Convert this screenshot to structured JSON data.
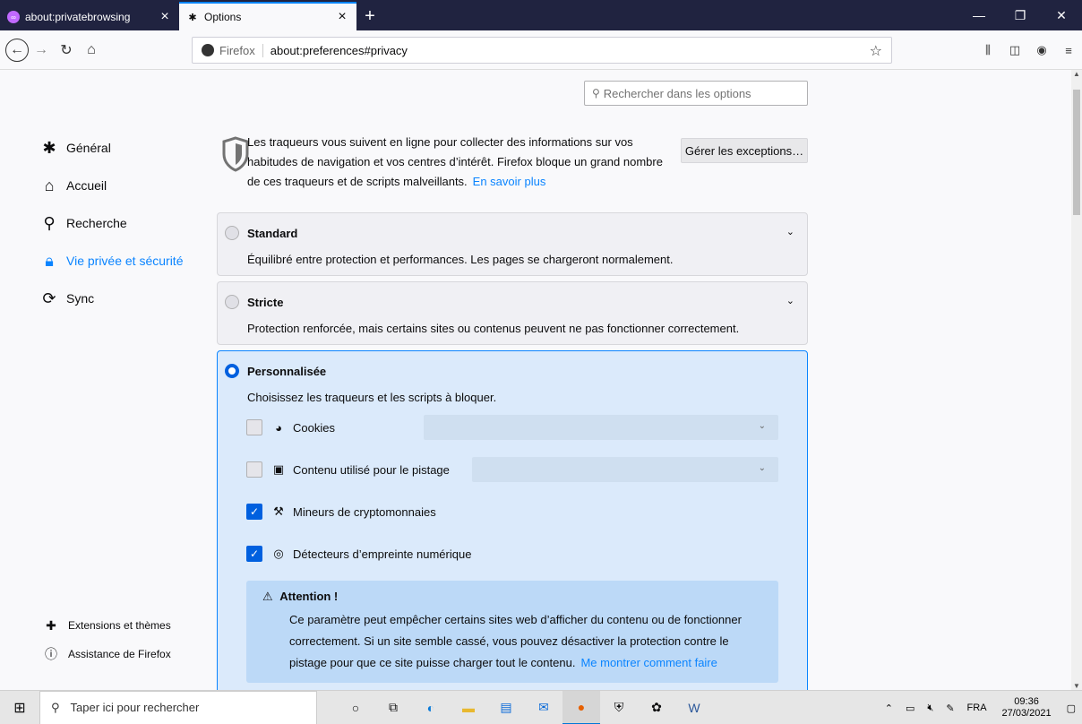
{
  "tabs": [
    {
      "title": "about:privatebrowsing",
      "icon": "private-mask-icon"
    },
    {
      "title": "Options",
      "icon": "gear-icon",
      "active": true
    }
  ],
  "window_controls": {
    "minimize": "—",
    "restore": "❐",
    "close": "✕"
  },
  "navbar": {
    "identity": "Firefox",
    "url": "about:preferences#privacy"
  },
  "search": {
    "placeholder": "Rechercher dans les options"
  },
  "sidebar": {
    "items": [
      {
        "label": "Général",
        "icon": "gear-icon"
      },
      {
        "label": "Accueil",
        "icon": "home-icon"
      },
      {
        "label": "Recherche",
        "icon": "search-icon"
      },
      {
        "label": "Vie privée et sécurité",
        "icon": "lock-icon",
        "selected": true
      },
      {
        "label": "Sync",
        "icon": "sync-icon"
      }
    ],
    "bottom": [
      {
        "label": "Extensions et thèmes",
        "icon": "puzzle-icon"
      },
      {
        "label": "Assistance de Firefox",
        "icon": "help-icon"
      }
    ]
  },
  "intro": {
    "text": "Les traqueurs vous suivent en ligne pour collecter des informations sur vos habitudes de navigation et vos centres d’intérêt. Firefox bloque un grand nombre de ces traqueurs et de scripts malveillants.",
    "link": "En savoir plus",
    "exceptions_button": "Gérer les exceptions…"
  },
  "options": {
    "standard": {
      "title": "Standard",
      "desc": "Équilibré entre protection et performances. Les pages se chargeront normalement."
    },
    "strict": {
      "title": "Stricte",
      "desc": "Protection renforcée, mais certains sites ou contenus peuvent ne pas fonctionner correctement."
    },
    "custom": {
      "title": "Personnalisée",
      "desc": "Choisissez les traqueurs et les scripts à bloquer."
    }
  },
  "custom_rows": [
    {
      "label": "Cookies",
      "checked": false,
      "icon": "cookie-icon"
    },
    {
      "label": "Contenu utilisé pour le pistage",
      "checked": false,
      "icon": "image-icon"
    },
    {
      "label": "Mineurs de cryptomonnaies",
      "checked": true,
      "icon": "pickaxe-icon"
    },
    {
      "label": "Détecteurs d’empreinte numérique",
      "checked": true,
      "icon": "fingerprint-icon"
    }
  ],
  "warning": {
    "title": "Attention !",
    "text": "Ce paramètre peut empêcher certains sites web d’afficher du contenu ou de fonctionner correctement. Si un site semble cassé, vous pouvez désactiver la protection contre le pistage pour que ce site puisse charger tout le contenu.",
    "link": "Me montrer comment faire"
  },
  "taskbar": {
    "search_placeholder": "Taper ici pour rechercher",
    "lang": "FRA",
    "time": "09:36",
    "date": "27/03/2021"
  },
  "colors": {
    "accent": "#0a84ff",
    "tabstrip": "#202340",
    "custom_bg": "#dbeafb"
  }
}
